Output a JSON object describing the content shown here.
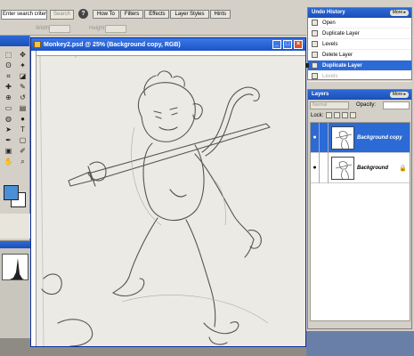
{
  "options_bar": {
    "search_value": "Enter search criteria",
    "search_button": "Search",
    "help_icon": "?",
    "tabs": [
      "How To",
      "Filters",
      "Effects",
      "Layer Styles",
      "Hints"
    ],
    "width_label": "Width:",
    "height_label": "Height:"
  },
  "tools": {
    "icons": [
      "marquee-icon",
      "move-icon",
      "lasso-icon",
      "magic-wand-icon",
      "crop-icon",
      "slice-icon",
      "healing-icon",
      "brush-icon",
      "stamp-icon",
      "history-brush-icon",
      "eraser-icon",
      "gradient-icon",
      "blur-icon",
      "dodge-icon",
      "path-select-icon",
      "type-icon",
      "pen-icon",
      "shape-icon",
      "notes-icon",
      "eyedropper-icon",
      "hand-icon",
      "zoom-icon"
    ],
    "glyphs": [
      "⬚",
      "✥",
      "ʘ",
      "✦",
      "⌗",
      "◪",
      "✚",
      "✎",
      "⊕",
      "↺",
      "▭",
      "▤",
      "◍",
      "●",
      "➤",
      "T",
      "✒",
      "▢",
      "▣",
      "✐",
      "✋",
      "⌕"
    ],
    "foreground_color": "#4a8fd6",
    "background_color": "#ffffff"
  },
  "document": {
    "title": "Monkey2.psd @ 25% (Background copy, RGB)",
    "minimize": "_",
    "maximize": "□",
    "close": "×"
  },
  "undo_history": {
    "title": "Undo History",
    "more": "More ▸",
    "items": [
      {
        "label": "Open",
        "state": "normal"
      },
      {
        "label": "Duplicate Layer",
        "state": "normal"
      },
      {
        "label": "Levels",
        "state": "normal"
      },
      {
        "label": "Delete Layer",
        "state": "normal"
      },
      {
        "label": "Duplicate Layer",
        "state": "selected"
      },
      {
        "label": "Levels",
        "state": "dim"
      }
    ]
  },
  "layers": {
    "title": "Layers",
    "more": "More ▸",
    "blend_mode": "Normal",
    "opacity_label": "Opacity:",
    "lock_label": "Lock:",
    "items": [
      {
        "name": "Background copy",
        "active": true,
        "locked": false
      },
      {
        "name": "Background",
        "active": false,
        "locked": true
      }
    ],
    "eye_glyph": "●",
    "lock_glyph": "🔒"
  },
  "colors": {
    "titlebar_blue": "#2c6ad6",
    "panel_grey": "#d4d0c8",
    "selection_blue": "#2c6ad6"
  }
}
